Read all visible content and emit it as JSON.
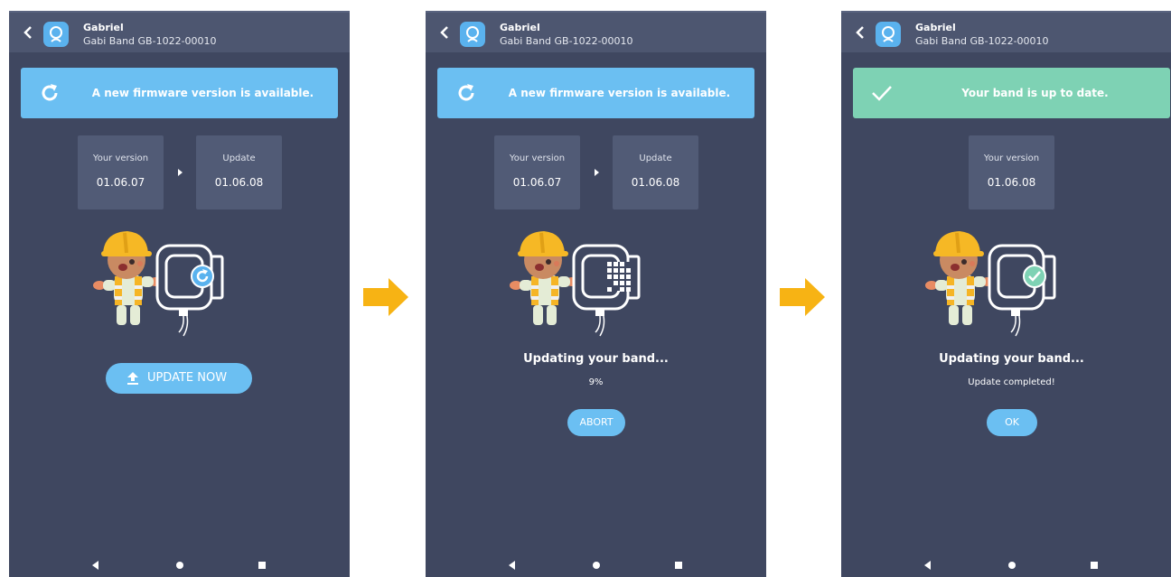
{
  "colors": {
    "screen_bg": "#3f4760",
    "topbar_bg": "#4d5670",
    "accent_blue": "#6bbff2",
    "success_green": "#7ed2b4",
    "flow_arrow": "#f7b314"
  },
  "screens": [
    {
      "header": {
        "user": "Gabriel",
        "device": "Gabi Band GB-1022-00010",
        "back_icon": "chevron-left-icon",
        "logo_icon": "gabi-logo-icon"
      },
      "banner": {
        "text": "A new firmware version is available.",
        "icon": "refresh-icon"
      },
      "current_version": {
        "label": "Your version",
        "value": "01.06.07"
      },
      "update_version": {
        "label": "Update",
        "value": "01.06.08"
      },
      "illustration": "worker-with-band-refresh",
      "button": {
        "label": "UPDATE NOW",
        "icon": "upload-icon"
      }
    },
    {
      "header": {
        "user": "Gabriel",
        "device": "Gabi Band GB-1022-00010"
      },
      "banner": {
        "text": "A new firmware version is available.",
        "icon": "refresh-icon"
      },
      "current_version": {
        "label": "Your version",
        "value": "01.06.07"
      },
      "update_version": {
        "label": "Update",
        "value": "01.06.08"
      },
      "illustration": "worker-with-band-progress",
      "status": {
        "title": "Updating your band...",
        "progress_text": "9%",
        "progress": 0.09
      },
      "button": {
        "label": "ABORT"
      }
    },
    {
      "header": {
        "user": "Gabriel",
        "device": "Gabi Band GB-1022-00010"
      },
      "banner": {
        "text": "Your band is up to date.",
        "icon": "check-icon"
      },
      "current_version": {
        "label": "Your version",
        "value": "01.06.08"
      },
      "illustration": "worker-with-band-check",
      "status": {
        "title": "Updating your band...",
        "subtitle": "Update completed!"
      },
      "button": {
        "label": "OK"
      }
    }
  ],
  "navbar": {
    "back_icon": "nav-back-icon",
    "home_icon": "nav-home-icon",
    "recents_icon": "nav-recents-icon"
  }
}
